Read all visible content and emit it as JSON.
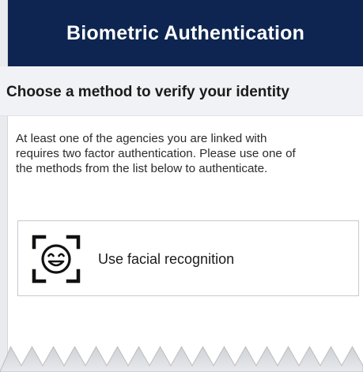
{
  "header": {
    "title": "Biometric Authentication"
  },
  "section": {
    "title": "Choose a method to verify your identity"
  },
  "description": {
    "lines": [
      "At least one of the agencies you are linked with",
      "requires two factor authentication. Please use one of",
      "the methods from the list below to authenticate."
    ]
  },
  "methods": [
    {
      "icon": "face-recognition-icon",
      "label": "Use facial recognition"
    }
  ],
  "colors": {
    "header_bg": "#0d2550",
    "section_bg": "#f1f2f5",
    "card_border": "#c7c9cd"
  }
}
